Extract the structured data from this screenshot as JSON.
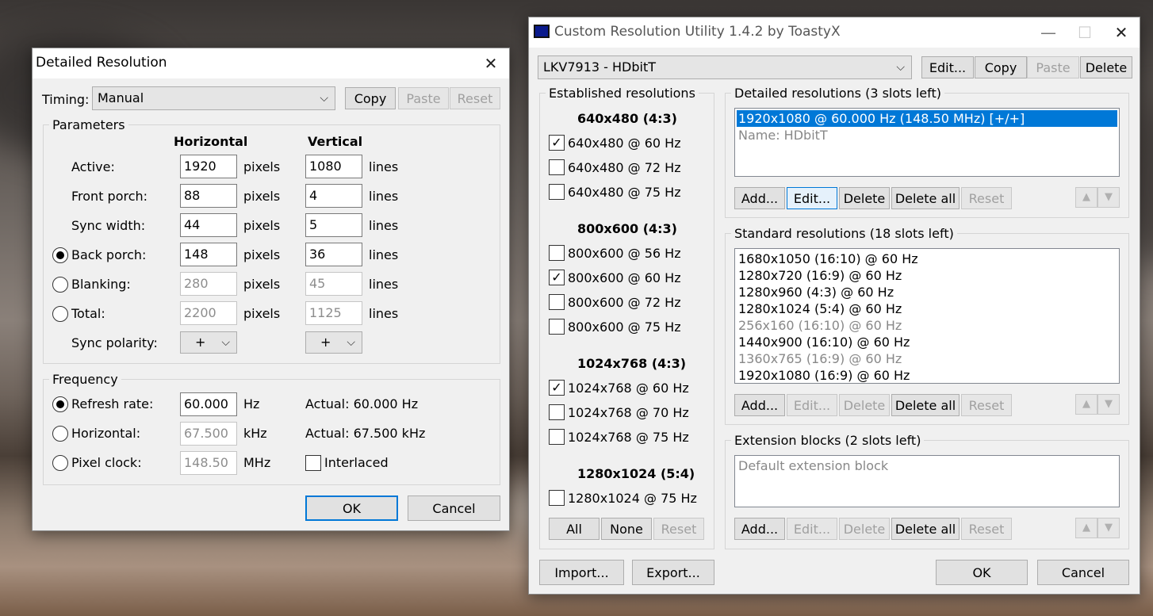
{
  "dialog": {
    "title": "Detailed Resolution",
    "timing": {
      "label": "Timing:",
      "value": "Manual",
      "copy": "Copy",
      "paste": "Paste",
      "reset": "Reset"
    },
    "parameters": {
      "group_title": "Parameters",
      "col_horizontal": "Horizontal",
      "col_vertical": "Vertical",
      "rows": [
        {
          "label": "Active:",
          "h": "1920",
          "v": "1080"
        },
        {
          "label": "Front porch:",
          "h": "88",
          "v": "4"
        },
        {
          "label": "Sync width:",
          "h": "44",
          "v": "5"
        },
        {
          "label": "Back porch:",
          "h": "148",
          "v": "36"
        },
        {
          "label": "Blanking:",
          "h": "280",
          "v": "45"
        },
        {
          "label": "Total:",
          "h": "2200",
          "v": "1125"
        }
      ],
      "h_unit": "pixels",
      "v_unit": "lines",
      "sync_polarity_label": "Sync polarity:",
      "h_polarity": "+",
      "v_polarity": "+"
    },
    "frequency": {
      "group_title": "Frequency",
      "refresh_label": "Refresh rate:",
      "refresh_value": "60.000",
      "refresh_unit": "Hz",
      "refresh_actual": "Actual: 60.000 Hz",
      "horizontal_label": "Horizontal:",
      "horizontal_value": "67.500",
      "horizontal_unit": "kHz",
      "horizontal_actual": "Actual: 67.500 kHz",
      "pixelclock_label": "Pixel clock:",
      "pixelclock_value": "148.50",
      "pixelclock_unit": "MHz",
      "interlaced_label": "Interlaced"
    },
    "ok": "OK",
    "cancel": "Cancel"
  },
  "cru": {
    "title": "Custom Resolution Utility 1.4.2 by ToastyX",
    "monitor": "LKV7913 - HDbitT",
    "top_buttons": {
      "edit": "Edit...",
      "copy": "Copy",
      "paste": "Paste",
      "delete": "Delete"
    },
    "established": {
      "title": "Established resolutions",
      "groups": [
        {
          "heading": "640x480 (4:3)",
          "items": [
            {
              "label": "640x480 @ 60 Hz",
              "checked": true
            },
            {
              "label": "640x480 @ 72 Hz",
              "checked": false
            },
            {
              "label": "640x480 @ 75 Hz",
              "checked": false
            }
          ]
        },
        {
          "heading": "800x600 (4:3)",
          "items": [
            {
              "label": "800x600 @ 56 Hz",
              "checked": false
            },
            {
              "label": "800x600 @ 60 Hz",
              "checked": true
            },
            {
              "label": "800x600 @ 72 Hz",
              "checked": false
            },
            {
              "label": "800x600 @ 75 Hz",
              "checked": false
            }
          ]
        },
        {
          "heading": "1024x768 (4:3)",
          "items": [
            {
              "label": "1024x768 @ 60 Hz",
              "checked": true
            },
            {
              "label": "1024x768 @ 70 Hz",
              "checked": false
            },
            {
              "label": "1024x768 @ 75 Hz",
              "checked": false
            }
          ]
        },
        {
          "heading": "1280x1024 (5:4)",
          "items": [
            {
              "label": "1280x1024 @ 75 Hz",
              "checked": false
            }
          ]
        }
      ],
      "all": "All",
      "none": "None",
      "reset": "Reset"
    },
    "detailed": {
      "title": "Detailed resolutions (3 slots left)",
      "items": [
        "1920x1080 @ 60.000 Hz (148.50 MHz) [+/+]",
        "Name: HDbitT"
      ],
      "buttons": {
        "add": "Add...",
        "edit": "Edit...",
        "delete": "Delete",
        "delete_all": "Delete all",
        "reset": "Reset"
      }
    },
    "standard": {
      "title": "Standard resolutions (18 slots left)",
      "items": [
        {
          "label": "1680x1050 (16:10) @ 60 Hz",
          "grey": false
        },
        {
          "label": "1280x720 (16:9) @ 60 Hz",
          "grey": false
        },
        {
          "label": "1280x960 (4:3) @ 60 Hz",
          "grey": false
        },
        {
          "label": "1280x1024 (5:4) @ 60 Hz",
          "grey": false
        },
        {
          "label": "256x160 (16:10) @ 60 Hz",
          "grey": true
        },
        {
          "label": "1440x900 (16:10) @ 60 Hz",
          "grey": false
        },
        {
          "label": "1360x765 (16:9) @ 60 Hz",
          "grey": true
        },
        {
          "label": "1920x1080 (16:9) @ 60 Hz",
          "grey": false
        }
      ],
      "buttons": {
        "add": "Add...",
        "edit": "Edit...",
        "delete": "Delete",
        "delete_all": "Delete all",
        "reset": "Reset"
      }
    },
    "extension": {
      "title": "Extension blocks (2 slots left)",
      "items": [
        "Default extension block"
      ],
      "buttons": {
        "add": "Add...",
        "edit": "Edit...",
        "delete": "Delete",
        "delete_all": "Delete all",
        "reset": "Reset"
      }
    },
    "import": "Import...",
    "export": "Export...",
    "ok": "OK",
    "cancel": "Cancel"
  }
}
